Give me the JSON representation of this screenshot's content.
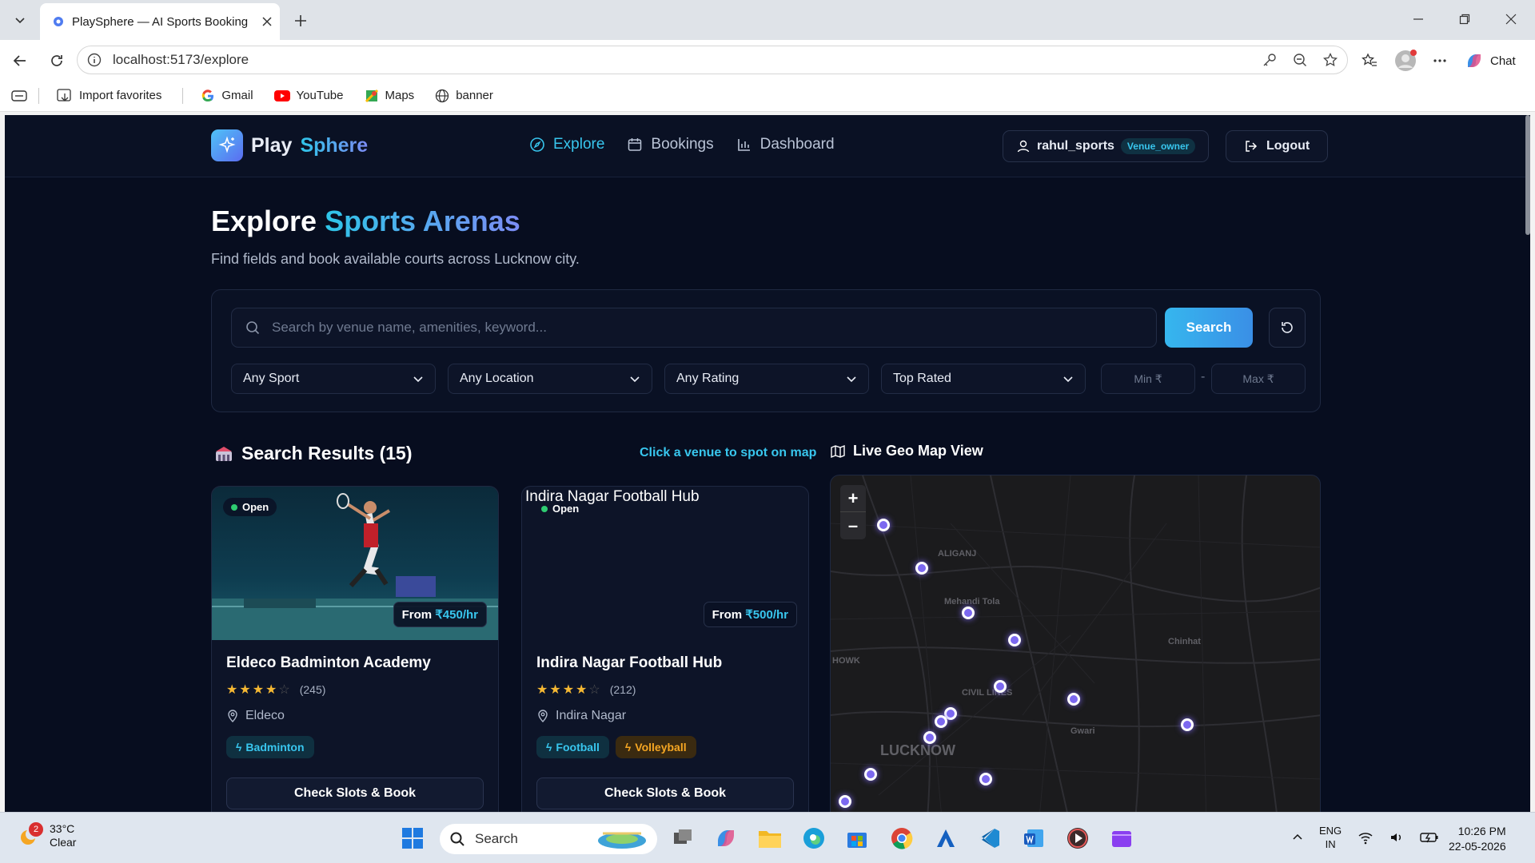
{
  "browser": {
    "tab_title": "PlaySphere — AI Sports Booking",
    "url": "localhost:5173/explore",
    "chat_label": "Chat",
    "bookmarks": [
      "Import favorites",
      "Gmail",
      "YouTube",
      "Maps",
      "banner"
    ]
  },
  "header": {
    "logo_play": "Play",
    "logo_sphere": "Sphere",
    "nav": [
      {
        "label": "Explore",
        "icon": "compass-icon",
        "active": true
      },
      {
        "label": "Bookings",
        "icon": "calendar-icon",
        "active": false
      },
      {
        "label": "Dashboard",
        "icon": "bar-chart-icon",
        "active": false
      }
    ],
    "username": "rahul_sports",
    "role": "Venue_owner",
    "logout_label": "Logout"
  },
  "hero": {
    "title_plain": "Explore",
    "title_accent": "Sports Arenas",
    "subtitle": "Find fields and book available courts across Lucknow city."
  },
  "filters": {
    "search_placeholder": "Search by venue name, amenities, keyword...",
    "search_button": "Search",
    "sport": "Any Sport",
    "location": "Any Location",
    "rating": "Any Rating",
    "sort": "Top Rated",
    "min_placeholder": "Min ₹",
    "max_placeholder": "Max ₹",
    "dash": "-"
  },
  "results": {
    "heading": "Search Results (15)",
    "hint": "Click a venue to spot on map",
    "venues": [
      {
        "name": "Eldeco Badminton Academy",
        "status": "Open",
        "price_prefix": "From",
        "price": "₹450/hr",
        "rating": 4,
        "reviews": "(245)",
        "location": "Eldeco",
        "tags": [
          "Badminton"
        ],
        "button": "Check Slots & Book"
      },
      {
        "name": "Indira Nagar Football Hub",
        "image_alt": "Indira Nagar Football Hub",
        "status": "Open",
        "price_prefix": "From",
        "price": "₹500/hr",
        "rating": 4,
        "reviews": "(212)",
        "location": "Indira Nagar",
        "tags": [
          "Football",
          "Volleyball"
        ],
        "button": "Check Slots & Book"
      }
    ]
  },
  "map": {
    "title": "Live Geo Map View",
    "zoom_in": "+",
    "zoom_out": "–",
    "labels": [
      "ALIGANJ",
      "Mehandi Tola",
      "Chinhat",
      "CIVIL LINES",
      "Gwari",
      "LUCKNOW",
      "HOWK"
    ]
  },
  "taskbar": {
    "temp": "33°C",
    "condition": "Clear",
    "notif_count": "2",
    "search": "Search",
    "lang": "ENG",
    "region": "IN",
    "time": "10:26 PM",
    "date": "22-05-2026"
  },
  "colors": {
    "accent": "#38c6ee",
    "brand_gradient_end": "#7c8cf5",
    "marker": "#7c68f0"
  }
}
